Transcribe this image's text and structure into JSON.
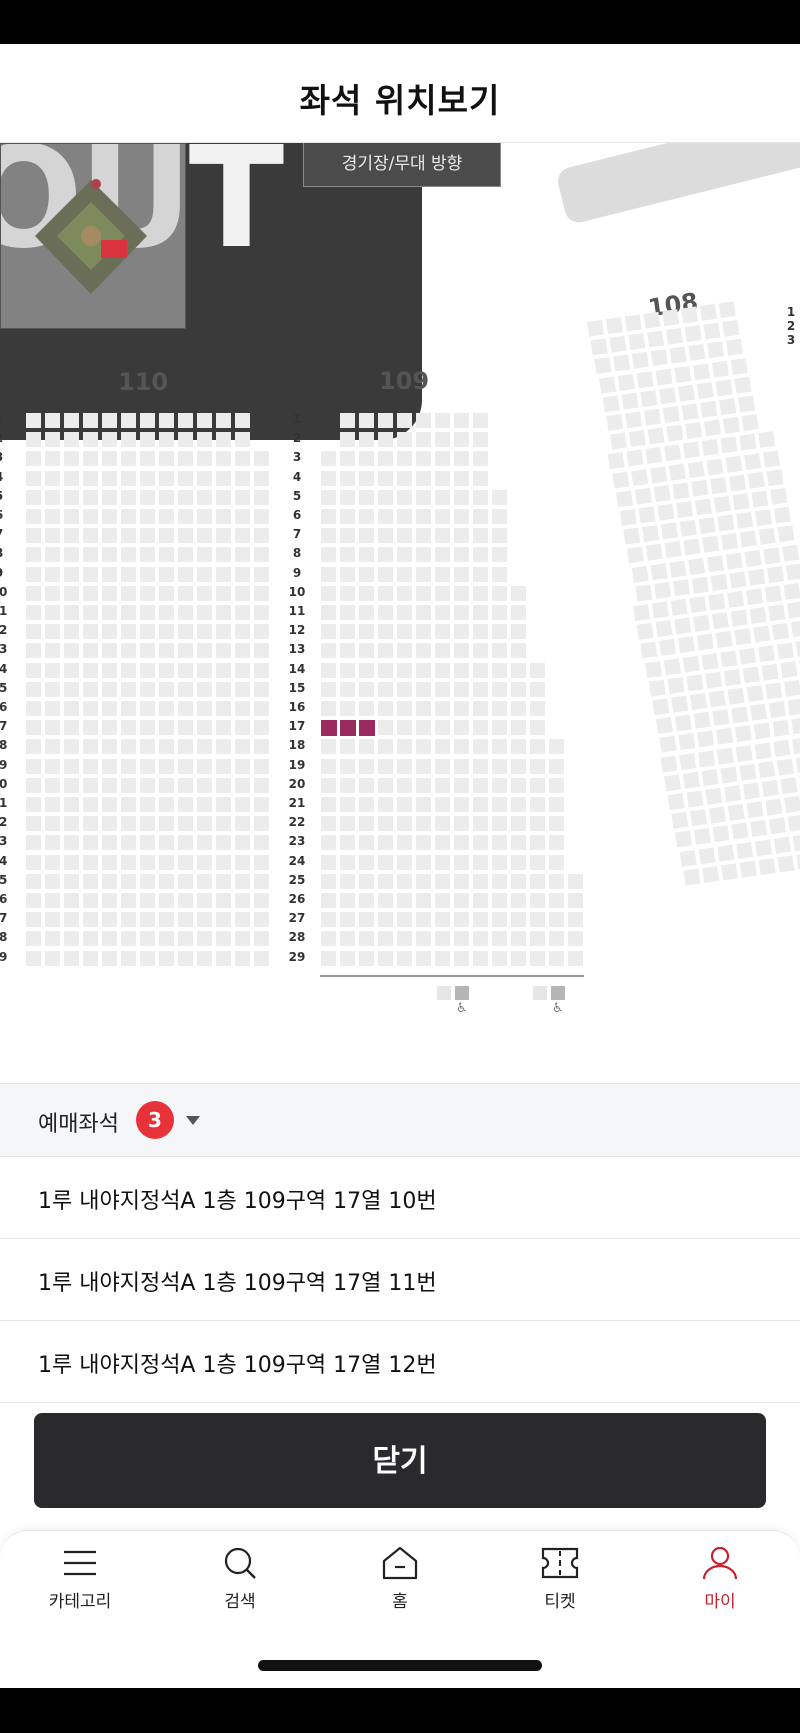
{
  "header": {
    "title": "좌석 위치보기"
  },
  "map": {
    "overlay_text": "OUT",
    "stage_label": "경기장/무대 방향",
    "sections": {
      "s110": "110",
      "s109": "109",
      "s108": "108"
    },
    "row_labels": [
      "1",
      "2",
      "3",
      "4",
      "5",
      "6",
      "7",
      "8",
      "9",
      "10",
      "11",
      "12",
      "13",
      "14",
      "15",
      "16",
      "17",
      "18",
      "19",
      "20",
      "21",
      "22",
      "23",
      "24",
      "25",
      "26",
      "27",
      "28",
      "29"
    ],
    "s108_row_labels": [
      "1",
      "2",
      "3"
    ],
    "selected_color": "#9b2a5f",
    "wheelchair_icon": "wheelchair-icon"
  },
  "reserved": {
    "label": "예매좌석",
    "count": "3",
    "items": [
      "1루 내야지정석A 1층 109구역 17열 10번",
      "1루 내야지정석A 1층 109구역 17열 11번",
      "1루 내야지정석A 1층 109구역 17열 12번"
    ]
  },
  "close_button": "닫기",
  "tabs": [
    {
      "label": "카테고리",
      "icon": "menu-icon",
      "active": false
    },
    {
      "label": "검색",
      "icon": "search-icon",
      "active": false
    },
    {
      "label": "홈",
      "icon": "home-icon",
      "active": false
    },
    {
      "label": "티켓",
      "icon": "ticket-icon",
      "active": false
    },
    {
      "label": "마이",
      "icon": "person-icon",
      "active": true
    }
  ],
  "colors": {
    "accent": "#c8202f",
    "badge": "#e8323a",
    "button": "#2a2a2c"
  }
}
